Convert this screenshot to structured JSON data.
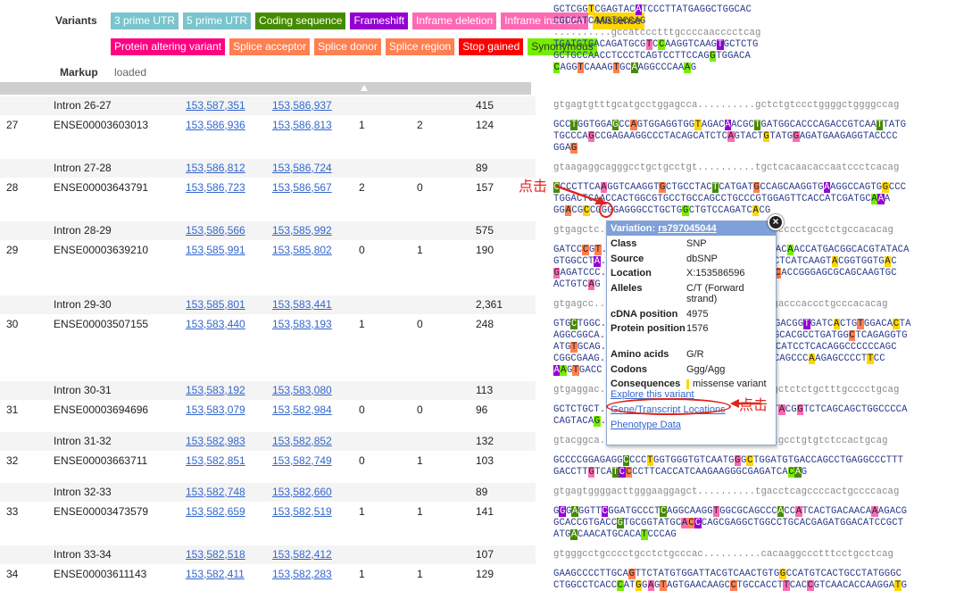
{
  "legend": {
    "variants_label": "Variants",
    "markup_label": "Markup",
    "markup_value": "loaded",
    "row1": [
      {
        "label": "3 prime UTR",
        "color": "#7ac5cd",
        "text_color": "#ffffff"
      },
      {
        "label": "5 prime UTR",
        "color": "#7ac5cd",
        "text_color": "#ffffff"
      },
      {
        "label": "Coding sequence",
        "color": "#458b00",
        "text_color": "#ffffff"
      },
      {
        "label": "Frameshift",
        "color": "#9400d3",
        "text_color": "#ffffff"
      },
      {
        "label": "Inframe deletion",
        "color": "#ff69b4",
        "text_color": "#ffffff"
      },
      {
        "label": "Inframe insertion",
        "color": "#ff69b4",
        "text_color": "#ffffff"
      },
      {
        "label": "Missense",
        "color": "#ffd700",
        "text_color": "#333333"
      }
    ],
    "row2": [
      {
        "label": "Protein altering variant",
        "color": "#ff0080",
        "text_color": "#ffffff"
      },
      {
        "label": "Splice acceptor",
        "color": "#ff7f50",
        "text_color": "#ffffff"
      },
      {
        "label": "Splice donor",
        "color": "#ff7f50",
        "text_color": "#ffffff"
      },
      {
        "label": "Splice region",
        "color": "#ff7f50",
        "text_color": "#ffffff"
      },
      {
        "label": "Stop gained",
        "color": "#ff0000",
        "text_color": "#ffffff"
      },
      {
        "label": "Synonymous",
        "color": "#76ee00",
        "text_color": "#333333"
      }
    ]
  },
  "rows": [
    {
      "no": "",
      "id": "Intron 26-27",
      "start": "153,587,351",
      "end": "153,586,937",
      "phase_s": "",
      "phase_e": "",
      "len": "415",
      "type": "intron",
      "seq": [
        "gtgagtgtttgcatgcctggagcca..........gctctgtccctggggctggggccag"
      ]
    },
    {
      "no": "27",
      "id": "ENSE00003603013",
      "start": "153,586,936",
      "end": "153,586,813",
      "phase_s": "1",
      "phase_e": "2",
      "len": "124",
      "type": "exon",
      "seq": [
        "GCCTGGTGGAGCCAGTGGAGGTGGTAGACAACGCTGATGGCACCCAGACCGTCAATTATG",
        "TGCCCAGCCGAGAAGGCCCTACAGCATCTCAGTACTGTATGGAGATGAAGAGGTACCCC",
        "GGAG"
      ]
    },
    {
      "no": "",
      "id": "Intron 27-28",
      "start": "153,586,812",
      "end": "153,586,724",
      "phase_s": "",
      "phase_e": "",
      "len": "89",
      "type": "intron",
      "seq": [
        "gtaagaggcagggcctgctgcctgt..........tgctcacaacaccaatccctcacag"
      ]
    },
    {
      "no": "28",
      "id": "ENSE00003643791",
      "start": "153,586,723",
      "end": "153,586,567",
      "phase_s": "2",
      "phase_e": "0",
      "len": "157",
      "type": "exon",
      "seq": [
        "CCCCTTCAAGGTCAAGGTGCTGCCTACTCATGATGCCAGCAAGGTGAAGGCCAGTGGCCC",
        "TGGACTCAACCACTGGCGTGCCTGCCAGCCTGCCCGTGGAGTTCACCATCGATGCAAA",
        "GGACGCCGGGGAGGGCCTGCTGGCTGTCCAGATCACG"
      ]
    },
    {
      "no": "",
      "id": "Intron 28-29",
      "start": "153,586,566",
      "end": "153,585,992",
      "phase_s": "",
      "phase_e": "",
      "len": "575",
      "type": "intron",
      "seq": [
        "gtgagctc..........................tgctccccctgcctctgccacacag"
      ]
    },
    {
      "no": "29",
      "id": "ENSE00003639210",
      "start": "153,585,991",
      "end": "153,585,802",
      "phase_s": "0",
      "phase_e": "1",
      "len": "190",
      "type": "exon",
      "seq": [
        "GATCCCGT..........................CAAGACAACCATGACGGCACGTATACA",
        "GTGGCCTA..........................CATCCTCATCAAGTACGGTGGTGAC",
        "GAGATCCC..........................GTGCCACCGGGAGCGCAGCAAGTGC",
        "ACTGTCAG"
      ]
    },
    {
      "no": "",
      "id": "Intron 29-30",
      "start": "153,585,801",
      "end": "153,583,441",
      "phase_s": "",
      "phase_e": "",
      "len": "2,361",
      "type": "intron",
      "seq": [
        "gtgagcc...........................ttgggacccaccctgcccacacag"
      ]
    },
    {
      "no": "30",
      "id": "ENSE00003507155",
      "start": "153,583,440",
      "end": "153,583,193",
      "phase_s": "1",
      "phase_e": "0",
      "len": "248",
      "type": "exon",
      "seq": [
        "GTGCTGGC..........................AGGAGACGGTGATCACTGTGGACACTA",
        "AGGCGGCA..........................CTGTGCACGCCTGATGGCTCAGAGGTG",
        "ATGTGCAG..........................GCGACATCCTCACAGGCCCCCCAGC",
        "CGGCGAAG..........................GCGGCAGCCCAAGAGCCCCTTCC",
        "AAGTGACC"
      ]
    },
    {
      "no": "",
      "id": "Intron 30-31",
      "start": "153,583,192",
      "end": "153,583,080",
      "phase_s": "",
      "phase_e": "",
      "len": "113",
      "type": "intron",
      "seq": [
        "gtgaggac..........................agcagctctctgctttgcccctgcag"
      ]
    },
    {
      "no": "31",
      "id": "ENSE00003694696",
      "start": "153,583,079",
      "end": "153,582,984",
      "phase_s": "0",
      "phase_e": "0",
      "len": "96",
      "type": "exon",
      "seq": [
        "GCTCTGCT..........................GCTCTACGGTCTCAGCAGCTGGCCCCA",
        "CAGTACAG..........................GTGG"
      ]
    },
    {
      "no": "",
      "id": "Intron 31-32",
      "start": "153,582,983",
      "end": "153,582,852",
      "phase_s": "",
      "phase_e": "",
      "len": "132",
      "type": "intron",
      "seq": [
        "gtacggca..........................cccatgcctgtgtctccactgcag"
      ]
    },
    {
      "no": "32",
      "id": "ENSE00003663711",
      "start": "153,582,851",
      "end": "153,582,749",
      "phase_s": "0",
      "phase_e": "1",
      "len": "103",
      "type": "exon",
      "seq": [
        "GCCCCGGAGAGGCCCCTGGTGGGTGTCAATGGGCTGGATGTGACCAGCCTGAGGCCCTTT",
        "GACCTTGTCATCCCCTTCACCATCAAGAAGGGCGAGATCACAG"
      ]
    },
    {
      "no": "",
      "id": "Intron 32-33",
      "start": "153,582,748",
      "end": "153,582,660",
      "phase_s": "",
      "phase_e": "",
      "len": "89",
      "type": "intron",
      "seq": [
        "gtgagtggggacttgggaaggagct..........tgacctcagccccactgccccacag"
      ]
    },
    {
      "no": "33",
      "id": "ENSE00003473579",
      "start": "153,582,659",
      "end": "153,582,519",
      "phase_s": "1",
      "phase_e": "1",
      "len": "141",
      "type": "exon",
      "seq": [
        "GGGAGGTTCGGATGCCCTCAGGCAAGGTGGCGCAGCCCACCATCACTGACAACAAAGACG",
        "GCACCGTGACCGTGCGGTATGCACCCAGCGAGGCTGGCCTGCACGAGATGGACATCCGCT",
        "ATGACAACATGCACATCCCAG"
      ]
    },
    {
      "no": "",
      "id": "Intron 33-34",
      "start": "153,582,518",
      "end": "153,582,412",
      "phase_s": "",
      "phase_e": "",
      "len": "107",
      "type": "intron",
      "seq": [
        "gtgggcctgcccctgcctctgcccac..........cacaaggccctttcctgcctcag"
      ]
    },
    {
      "no": "34",
      "id": "ENSE00003611143",
      "start": "153,582,411",
      "end": "153,582,283",
      "phase_s": "1",
      "phase_e": "1",
      "len": "129",
      "type": "exon",
      "seq": [
        "GAAGCCCCTTGCAGTTCTATGTGGATTACGTCAACTGTGGCCATGTCACTGCCTATGGGC",
        "CTGGCCTCACCCATGGAGTAGTGAACAAGCCTGCCACCTTCACCGTCAACACCAAGGATG"
      ]
    }
  ],
  "top_seq": [
    "GCTCGGTCGAGTACATCCCTTATGAGGCTGGCAC",
    "CGCCATCAAGTGCCAG",
    "..........gccatccctttgccccaacccctcag",
    "TGATGTGACAGATGCGTCCAAGGTCAAGTGCTCTG",
    "GCTGCCAACCTCCCTCAGTCCTTCCAGGTGGACA",
    "CAGGTCAAAGTGCAAGGCCCAAAG"
  ],
  "popup": {
    "title_prefix": "Variation: ",
    "title_link": "rs797045044",
    "fields": [
      {
        "k": "Class",
        "v": "SNP"
      },
      {
        "k": "Source",
        "v": "dbSNP"
      },
      {
        "k": "Location",
        "v": "X:153586596"
      },
      {
        "k": "Alleles",
        "v": "C/T (Forward strand)"
      },
      {
        "k": "cDNA position",
        "v": "4975"
      },
      {
        "k": "Protein position",
        "v": "1576"
      },
      {
        "k": "Amino acids",
        "v": "G/R"
      },
      {
        "k": "Codons",
        "v": "Ggg/Agg"
      },
      {
        "k": "Consequences",
        "v": "missense variant"
      }
    ],
    "links": [
      "Explore this variant",
      "Gene/Transcript Locations",
      "Phenotype Data"
    ],
    "close": "×",
    "consequence_color": "#ffd700"
  },
  "annotations": {
    "click_1": "点击",
    "click_2": "点击",
    "color": "#e0231b"
  }
}
